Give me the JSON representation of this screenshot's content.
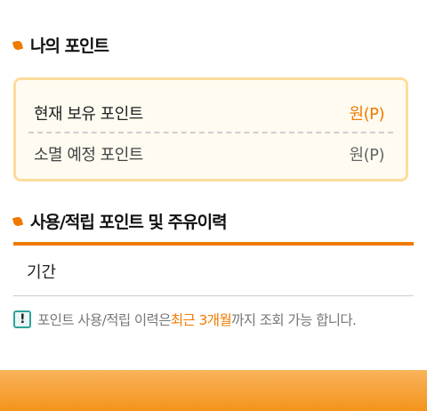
{
  "section1": {
    "title": "나의 포인트"
  },
  "points": {
    "held_label": "현재 보유 포인트",
    "held_value": "원(P)",
    "expiring_label": "소멸 예정 포인트",
    "expiring_value": "원(P)"
  },
  "section2": {
    "title": "사용/적립 포인트 및 주유이력"
  },
  "history": {
    "period_label": "기간"
  },
  "notice": {
    "prefix": "포인트 사용/적립 이력은 ",
    "highlight": "최근 3개월",
    "suffix": "까지 조회 가능 합니다."
  },
  "colors": {
    "accent": "#ef7a00",
    "box_border": "#fddc9b",
    "notice_icon": "#2fa39a"
  },
  "icons": {
    "bullet": "orange-leaf-bullet-icon",
    "notice": "exclamation-info-icon"
  }
}
